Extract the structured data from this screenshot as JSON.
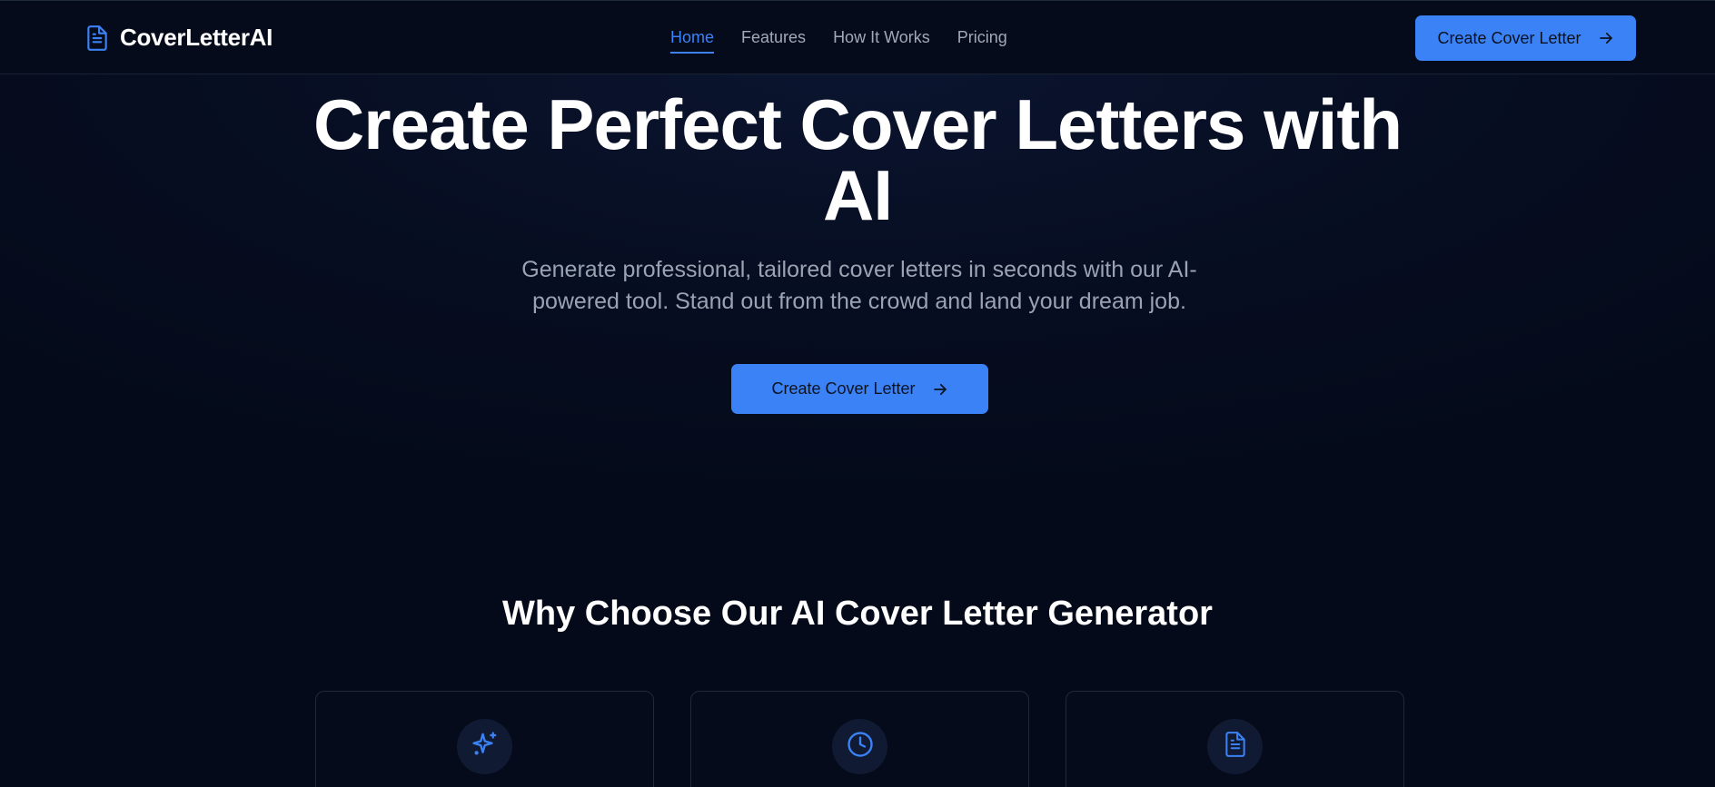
{
  "brand": {
    "name": "CoverLetterAI",
    "icon": "document-icon"
  },
  "nav": {
    "links": [
      {
        "label": "Home",
        "active": true
      },
      {
        "label": "Features",
        "active": false
      },
      {
        "label": "How It Works",
        "active": false
      },
      {
        "label": "Pricing",
        "active": false
      }
    ],
    "cta_label": "Create Cover Letter"
  },
  "hero": {
    "title_line1": "Create Perfect Cover Letters with",
    "title_line2": "AI",
    "subtitle": "Generate professional, tailored cover letters in seconds with our AI-powered tool. Stand out from the crowd and land your dream job.",
    "cta_label": "Create Cover Letter"
  },
  "features": {
    "title": "Why Choose Our AI Cover Letter Generator",
    "cards": [
      {
        "icon": "sparkles-icon"
      },
      {
        "icon": "clock-icon"
      },
      {
        "icon": "document-icon"
      }
    ]
  },
  "colors": {
    "accent": "#3b82f6",
    "background": "#040a19",
    "muted_text": "#9aa3b2"
  }
}
